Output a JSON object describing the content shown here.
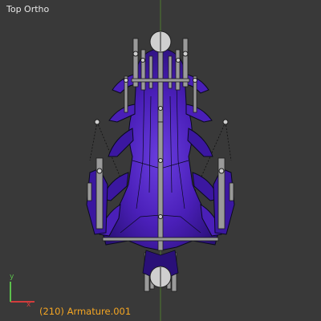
{
  "viewport": {
    "view_label": "Top Ortho",
    "object_info": "(210) Armature.001",
    "axes": {
      "x_label": "x",
      "y_label": "y"
    },
    "colors": {
      "background": "#393939",
      "grid_axis": "#4f7a2e",
      "mesh_fill": "#4a1fb8",
      "mesh_dark": "#2a1078",
      "mesh_edge": "#0a0a1e",
      "bone": "#9a9a9a",
      "bone_edge": "#1e1e1e",
      "info_text": "#f5a623",
      "x_axis": "#d23c3c",
      "y_axis": "#5cc04c"
    }
  }
}
